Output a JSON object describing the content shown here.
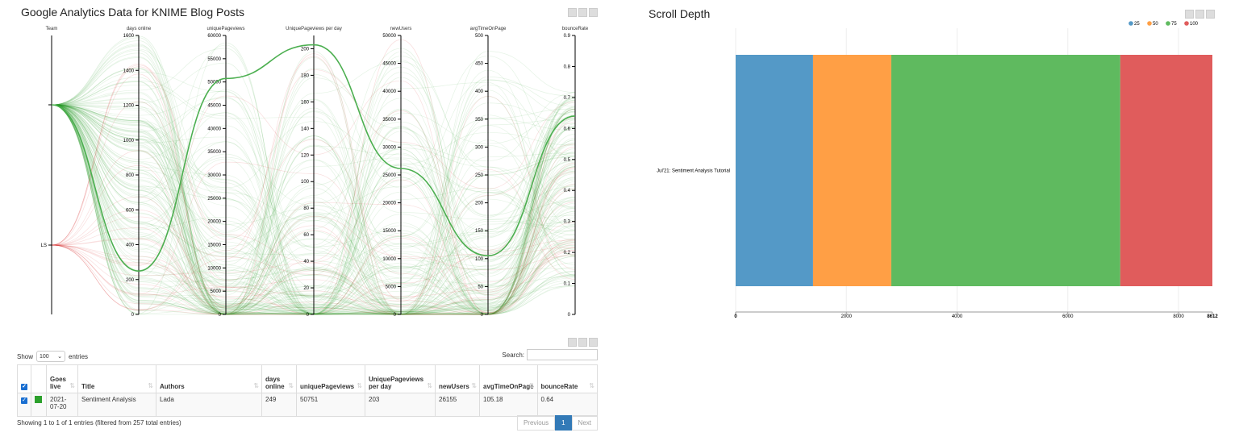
{
  "left_panel": {
    "title": "Google Analytics Data for KNIME Blog Posts"
  },
  "right_panel": {
    "title": "Scroll Depth"
  },
  "chart_data": [
    {
      "type": "parallel-coordinates",
      "axes": [
        {
          "name": "Team",
          "categories": [
            "",
            "LS"
          ]
        },
        {
          "name": "days online",
          "range": [
            0,
            1600
          ],
          "ticks": [
            "0",
            "200",
            "400",
            "600",
            "800",
            "1000",
            "1200",
            "1400",
            "1600"
          ]
        },
        {
          "name": "uniquePageviews",
          "range": [
            0,
            60000
          ],
          "ticks": [
            "0",
            "5000",
            "10000",
            "15000",
            "20000",
            "25000",
            "30000",
            "35000",
            "40000",
            "45000",
            "50000",
            "55000",
            "60000"
          ]
        },
        {
          "name": "UniquePageviews per day",
          "range": [
            0,
            210
          ],
          "ticks": [
            "0",
            "20",
            "40",
            "60",
            "80",
            "100",
            "120",
            "140",
            "160",
            "180",
            "200"
          ]
        },
        {
          "name": "newUsers",
          "range": [
            0,
            50000
          ],
          "ticks": [
            "0",
            "5000",
            "10000",
            "15000",
            "20000",
            "25000",
            "30000",
            "35000",
            "40000",
            "45000",
            "50000"
          ]
        },
        {
          "name": "avgTimeOnPage",
          "range": [
            0,
            500
          ],
          "ticks": [
            "0",
            "50",
            "100",
            "150",
            "200",
            "250",
            "300",
            "350",
            "400",
            "450",
            "500"
          ]
        },
        {
          "name": "bounceRate",
          "range": [
            0,
            0.9
          ],
          "ticks": [
            "0",
            "0.1",
            "0.2",
            "0.3",
            "0.4",
            "0.5",
            "0.6",
            "0.7",
            "0.8",
            "0.9"
          ]
        }
      ],
      "highlighted": {
        "team": "",
        "days_online": 249,
        "uniquePageviews": 50751,
        "per_day": 203,
        "newUsers": 26155,
        "avgTimeOnPage": 105.18,
        "bounceRate": 0.64
      },
      "highlight_color": "#4caf50",
      "background_colors": [
        "#2ca02c",
        "#d62728"
      ]
    },
    {
      "type": "bar",
      "orientation": "horizontal",
      "stacked": true,
      "categories": [
        "Jul'21: Sentiment Analysis Tutorial"
      ],
      "series": [
        {
          "name": "25",
          "values": [
            1398
          ],
          "color": "#5499c7"
        },
        {
          "name": "50",
          "values": [
            1413
          ],
          "color": "#ff9f45"
        },
        {
          "name": "75",
          "values": [
            4137
          ],
          "color": "#5fba5f"
        },
        {
          "name": "100",
          "values": [
            1664
          ],
          "color": "#e05c5c"
        }
      ],
      "xlim": [
        0,
        8612
      ],
      "xticks": [
        "0",
        "2000",
        "4000",
        "6000",
        "8000",
        "8612"
      ],
      "legend": "top-right",
      "grid": true
    }
  ],
  "table": {
    "show_label": "Show",
    "entries_value": "100",
    "entries_label": "entries",
    "search_label": "Search:",
    "search_value": "",
    "columns": [
      "Goes live",
      "Title",
      "Authors",
      "days online",
      "uniquePageviews",
      "UniquePageviews per day",
      "newUsers",
      "avgTimeOnPage",
      "bounceRate"
    ],
    "rows": [
      [
        "2021-07-20",
        "Sentiment Analysis",
        "Lada",
        "249",
        "50751",
        "203",
        "26155",
        "105.18",
        "0.64"
      ]
    ],
    "info": "Showing 1 to 1 of 1 entries (filtered from 257 total entries)",
    "pager": {
      "previous": "Previous",
      "current": "1",
      "next": "Next"
    }
  }
}
